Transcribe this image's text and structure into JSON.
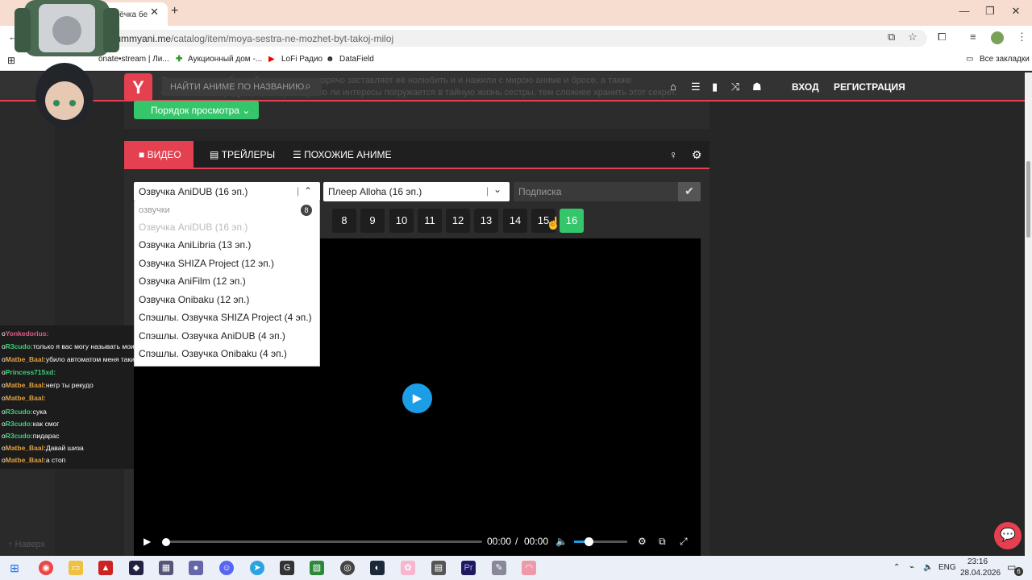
{
  "browser": {
    "tab_title": "трёчка бе",
    "url_domain": ".yummyani.me",
    "url_path": "/catalog/item/moya-sestra-ne-mozhet-byt-takoj-miloj",
    "bookmarks": [
      "onate•stream | Ли...",
      "Аукционный дом -...",
      "LoFi Радио",
      "DataField"
    ],
    "all_bookmarks": "Все закладки"
  },
  "site": {
    "logo": "Y",
    "search_placeholder": "НАЙТИ АНИМЕ ПО НАЗВАНИЮ",
    "ghost_text": "Эта девушка с обычной внешностью, горячо заставляет её нолюбить и и нажили с мирою аниме и бросе, а также сточнических продукции, которых нужно ли интересы погружается в тайную жизнь сестры, тем сложнее хранить этот секрет.",
    "login": "ВХОД",
    "register": "РЕГИСТРАЦИЯ",
    "order_button": "Порядок просмотра"
  },
  "player_tabs": {
    "video": "ВИДЕО",
    "trailers": "ТРЕЙЛЕРЫ",
    "similar": "ПОХОЖИЕ АНИМЕ"
  },
  "selectors": {
    "dub": "Озвучка AniDUB (16 эп.)",
    "player": "Плеер Alloha (16 эп.)",
    "subscribe_placeholder": "Подписка"
  },
  "dropdown": {
    "header": "озвучки",
    "count": "8",
    "items": [
      "Озвучка AniDUB (16 эп.)",
      "Озвучка AniLibria (13 эп.)",
      "Озвучка SHIZA Project (12 эп.)",
      "Озвучка AniFilm (12 эп.)",
      "Озвучка Onibaku (12 эп.)",
      "Спэшлы. Озвучка SHIZA Project (4 эп.)",
      "Спэшлы. Озвучка AniDUB (4 эп.)",
      "Спэшлы. Озвучка Onibaku (4 эп.)"
    ]
  },
  "episodes": [
    "8",
    "9",
    "10",
    "11",
    "12",
    "13",
    "14",
    "15",
    "16"
  ],
  "active_episode": "16",
  "video": {
    "current": "00:00",
    "separator": "/",
    "duration": "00:00",
    "volume_level": 0.28
  },
  "chat": [
    {
      "user": "Yonkedorius:",
      "text": "",
      "color": "#e05a8a"
    },
    {
      "user": "R3cudo:",
      "text": "только я вас могу называть моими неграми",
      "color": "#3fd07a"
    },
    {
      "user": "Matbe_Baal:",
      "text": "убило автоматом меня таки",
      "color": "#e0a040"
    },
    {
      "user": "Princess715xd:",
      "text": "",
      "color": "#3fd07a"
    },
    {
      "user": "Matbe_Baal:",
      "text": "",
      "color": "#e0a040"
    },
    {
      "user": "Matbe_Baal:",
      "text": "негр ты рекудо",
      "color": "#e0a040"
    },
    {
      "user": "R3cudo:",
      "text": "сука",
      "color": "#3fd07a"
    },
    {
      "user": "R3cudo:",
      "text": "как смог",
      "color": "#3fd07a"
    },
    {
      "user": "R3cudo:",
      "text": "пидарас",
      "color": "#3fd07a"
    },
    {
      "user": "Matbe_Baal:",
      "text": "Давай шиза",
      "color": "#e0a040"
    },
    {
      "user": "Matbe_Baal:",
      "text": "а стоп",
      "color": "#e0a040"
    }
  ],
  "up_link": "↑ Наверх",
  "tray": {
    "lang": "ENG",
    "time": "23:16",
    "date": "28.04.2026",
    "notif": "6"
  }
}
